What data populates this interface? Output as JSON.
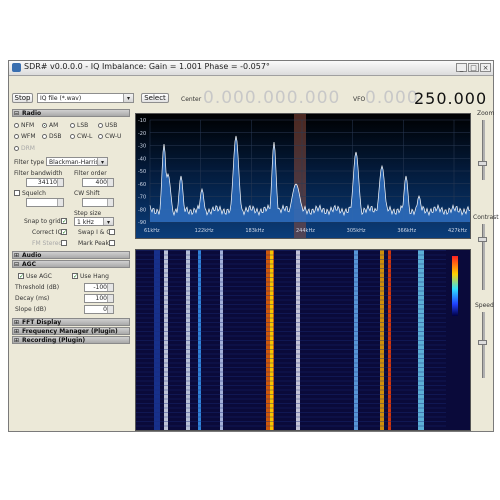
{
  "window": {
    "title": "SDR# v0.0.0.0 - IQ Imbalance: Gain = 1.001 Phase = -0.057°",
    "minimize": "_",
    "maximize": "□",
    "close": "×"
  },
  "toolbar": {
    "stop_label": "Stop",
    "source_value": "IQ file (*.wav)",
    "select_label": "Select",
    "center_label": "Center",
    "center_freq": "0.000.000.000",
    "vfo_label": "VFO",
    "vfo_prefix": "0.000.",
    "vfo_main": "250.000"
  },
  "radio": {
    "header": "Radio",
    "modes": [
      {
        "label": "NFM",
        "selected": false
      },
      {
        "label": "AM",
        "selected": true
      },
      {
        "label": "LSB",
        "selected": false
      },
      {
        "label": "USB",
        "selected": false
      },
      {
        "label": "WFM",
        "selected": false
      },
      {
        "label": "DSB",
        "selected": false
      },
      {
        "label": "CW-L",
        "selected": false
      },
      {
        "label": "CW-U",
        "selected": false
      }
    ],
    "extra_mode": "DRM",
    "filter_type_label": "Filter type",
    "filter_type_value": "Blackman-Harris",
    "filter_bandwidth_label": "Filter bandwidth",
    "filter_bandwidth_value": "34110",
    "filter_order_label": "Filter order",
    "filter_order_value": "400",
    "squelch_label": "Squelch",
    "cw_shift_label": "CW Shift",
    "step_size_label": "Step size",
    "snap_to_grid_label": "Snap to grid",
    "step_size_value": "1 kHz",
    "correct_iq_label": "Correct IQ",
    "swap_iq_label": "Swap I & Q",
    "fm_stereo_label": "FM Stereo",
    "mark_peaks_label": "Mark Peaks"
  },
  "audio": {
    "header": "Audio"
  },
  "agc": {
    "header": "AGC",
    "use_agc_label": "Use AGC",
    "use_hang_label": "Use Hang",
    "threshold_label": "Threshold (dB)",
    "threshold_value": "-100",
    "decay_label": "Decay (ms)",
    "decay_value": "100",
    "slope_label": "Slope (dB)",
    "slope_value": "0"
  },
  "plugins": [
    {
      "header": "FFT Display"
    },
    {
      "header": "Frequency Manager (Plugin)"
    },
    {
      "header": "Recording (Plugin)"
    }
  ],
  "spectrum": {
    "y_labels": [
      "-10",
      "-20",
      "-30",
      "-40",
      "-50",
      "-60",
      "-70",
      "-80",
      "-90"
    ],
    "x_labels": [
      "61kHz",
      "122kHz",
      "183kHz",
      "244kHz",
      "305kHz",
      "366kHz",
      "427kHz"
    ]
  },
  "side_sliders": {
    "zoom_label": "Zoom",
    "contrast_label": "Contrast",
    "speed_label": "Speed"
  },
  "colors": {
    "spectrum_fill": "#2f6fc0",
    "spectrum_line": "#ffffff",
    "waterfall_bg": "#0a0a3a",
    "vfo_marker": "#8a4a3a"
  }
}
